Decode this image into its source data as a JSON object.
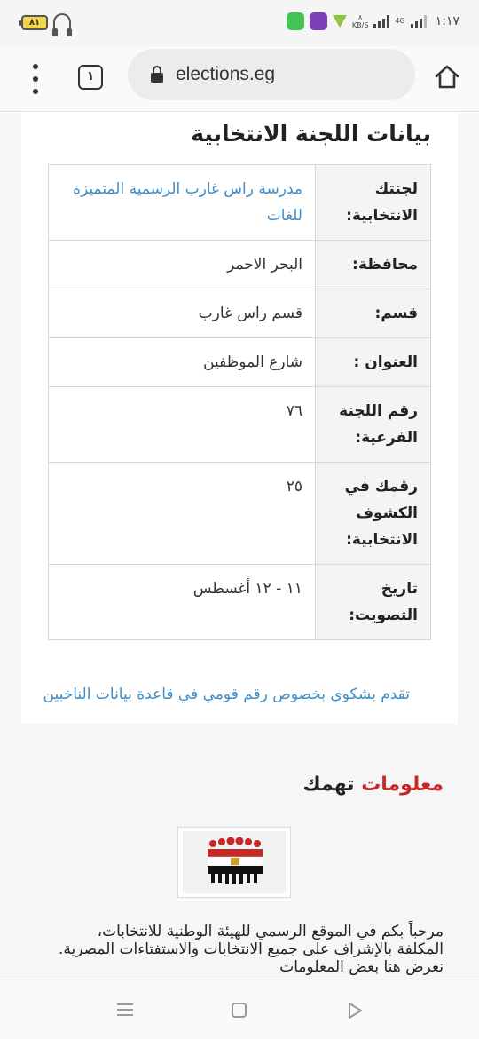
{
  "status_bar": {
    "battery": "٨١",
    "speed_top": "٨",
    "speed_unit": "KB/S",
    "network": "4G",
    "time": "١:١٧"
  },
  "browser": {
    "menu_icon": "overflow-menu-icon",
    "tab_count": "١",
    "url": "elections.eg",
    "home_icon": "home-icon"
  },
  "committee": {
    "title": "بيانات اللجنة الانتخابية",
    "rows": [
      {
        "label": "لجنتك الانتخابية:",
        "value": "مدرسة راس غارب الرسمية المتميزة للغات",
        "link": true
      },
      {
        "label": "محافظة:",
        "value": "البحر الاحمر",
        "link": false
      },
      {
        "label": "قسم:",
        "value": "قسم راس غارب",
        "link": false
      },
      {
        "label": "العنوان :",
        "value": "شارع الموظفين",
        "link": false
      },
      {
        "label": "رقم اللجنة الفرعية:",
        "value": "٧٦",
        "link": false
      },
      {
        "label": "رقمك في الكشوف الانتخابية:",
        "value": "٢٥",
        "link": false
      },
      {
        "label": "تاريخ التصويت:",
        "value": "١١ - ١٢ أغسطس",
        "link": false
      }
    ],
    "complaint_link": "تقدم بشكوى بخصوص رقم قومي في قاعدة بيانات الناخبين"
  },
  "info": {
    "title_part1": "معلومات",
    "title_part2": "تهمك",
    "welcome_text": "مرحباً بكم في الموقع الرسمي للهيئة الوطنية للانتخابات، المكلفة بالإشراف على جميع الانتخابات والاستفتاءات المصرية. نعرض هنا بعض المعلومات"
  },
  "colors": {
    "link": "#3f8ec8",
    "accent_red": "#c62828"
  }
}
